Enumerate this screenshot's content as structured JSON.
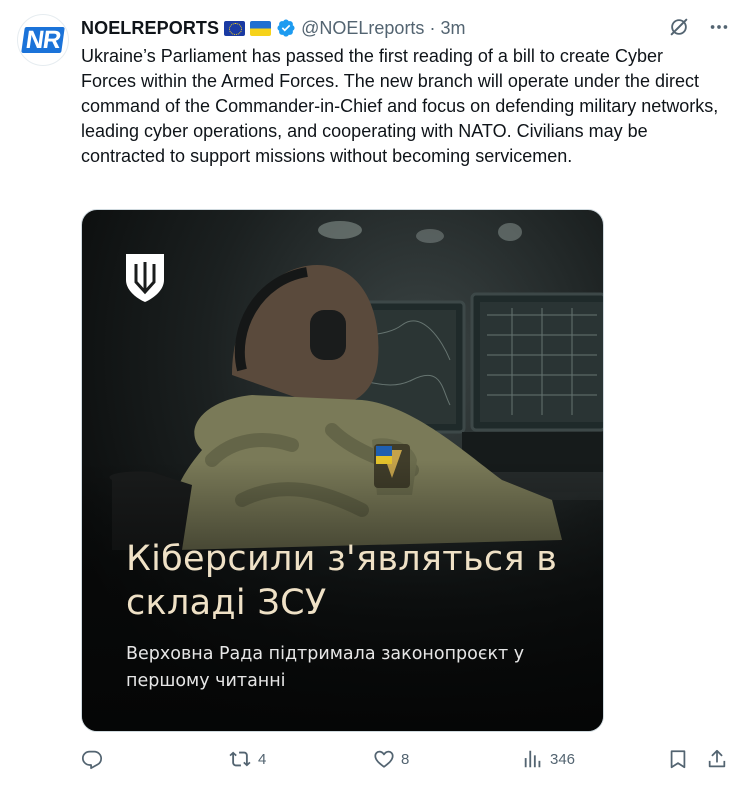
{
  "author": {
    "avatar_text": "NR",
    "display_name": "NOELREPORTS",
    "flags": [
      "eu-flag-icon",
      "ukraine-flag-icon"
    ],
    "handle": "@NOELreports",
    "separator": "·",
    "time": "3m"
  },
  "tweet": {
    "text": "Ukraine’s Parliament has passed the first reading of a bill to create Cyber Forces within the Armed Forces. The new branch will operate under the direct command of the Commander-in-Chief and focus on defending military networks, leading cyber operations, and cooperating with NATO. Civilians may be contracted to support missions without becoming servicemen."
  },
  "media": {
    "headline": "Кіберсили з'являться в складі ЗСУ",
    "subtitle": "Верховна Рада підтримала законопроєкт у першому читанні",
    "emblem": "tryzub-emblem"
  },
  "actions": {
    "replies": "",
    "reposts": "4",
    "likes": "8",
    "views": "346"
  },
  "colors": {
    "accent": "#1d9bf0",
    "muted": "#536471",
    "headline": "#efe1c6"
  },
  "icons": {
    "more": "more-dots-icon",
    "grok": "grok-icon",
    "reply": "reply-icon",
    "repost": "repost-icon",
    "like": "heart-icon",
    "views": "views-chart-icon",
    "bookmark": "bookmark-icon",
    "share": "share-icon"
  }
}
